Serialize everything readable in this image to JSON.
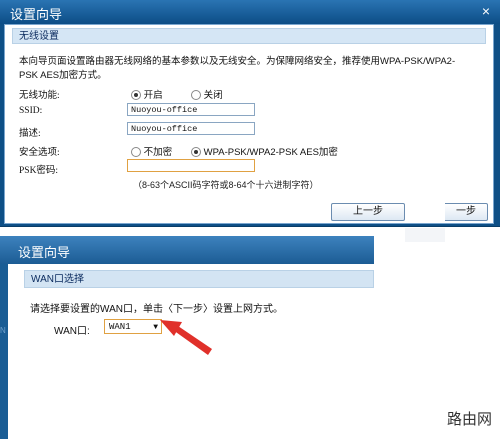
{
  "dialog1": {
    "title": "设置向导",
    "close_symbol": "×",
    "section_title": "无线设置",
    "description": "本向导页面设置路由器无线网络的基本参数以及无线安全。为保障网络安全，推荐使用WPA-PSK/WPA2-PSK AES加密方式。",
    "wireless_label": "无线功能:",
    "wireless_on": "开启",
    "wireless_off": "关闭",
    "wireless_state": "on",
    "ssid_label": "SSID:",
    "ssid_value": "Nuoyou-office",
    "desc_label": "描述:",
    "desc_value": "Nuoyou-office",
    "security_label": "安全选项:",
    "security_none": "不加密",
    "security_wpa": "WPA-PSK/WPA2-PSK AES加密",
    "security_state": "wpa",
    "psk_label": "PSK密码:",
    "psk_value": "",
    "psk_hint": "（8-63个ASCII码字符或8-64个十六进制字符）",
    "prev_button": "上一步",
    "next_button_partial": "一步"
  },
  "dialog2": {
    "title": "设置向导",
    "section_title": "WAN口选择",
    "description": "请选择要设置的WAN口，单击〈下一步〉设置上网方式。",
    "wan_label": "WAN口:",
    "wan_selected": "WAN1",
    "left_edge_text": "N"
  },
  "watermark": "路由网",
  "colors": {
    "title_bar": "#0c4d86",
    "section_bg": "#d5e6f5",
    "arrow": "#e0302a",
    "select_border": "#e0a142"
  }
}
